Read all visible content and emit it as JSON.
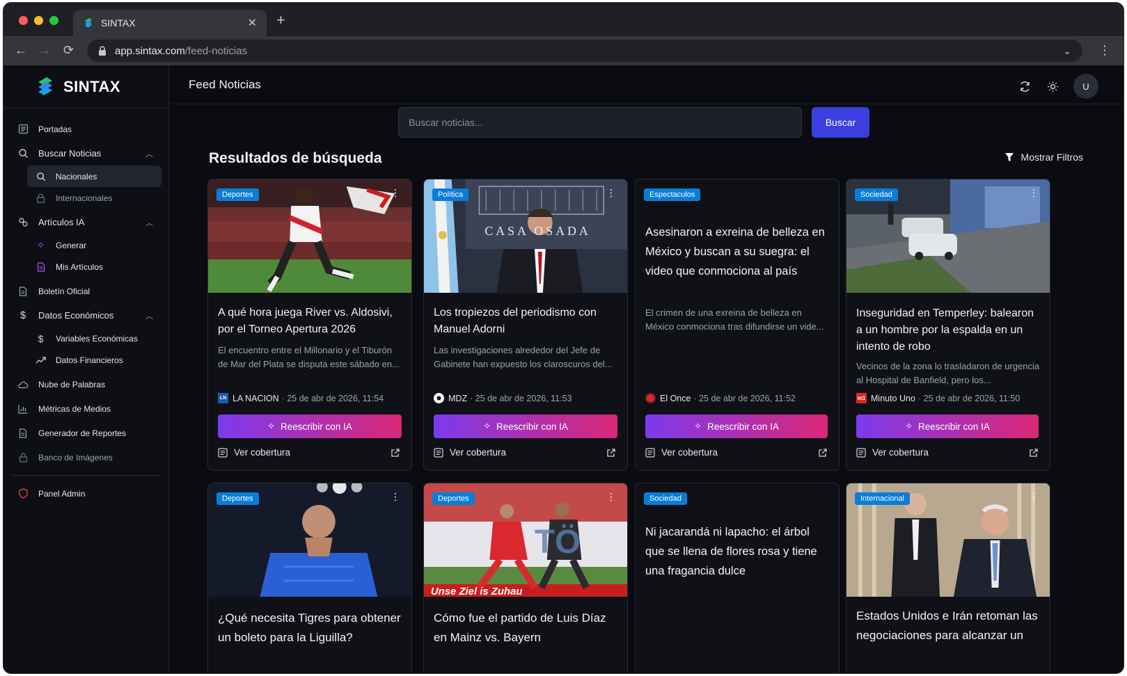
{
  "browser": {
    "tab_title": "SINTAX",
    "url_host": "app.sintax.com",
    "url_path": "/feed-noticias"
  },
  "sidebar": {
    "brand": "SINTAX",
    "items": {
      "portadas": "Portadas",
      "buscar": "Buscar Noticias",
      "nacionales": "Nacionales",
      "internacionales": "Internacionales",
      "articulos": "Artículos IA",
      "generar": "Generar",
      "mis_articulos": "Mis Artículos",
      "boletin": "Boletín Oficial",
      "datos": "Datos Económicos",
      "variables": "Variables Económicas",
      "financieros": "Datos Financieros",
      "nube": "Nube de Palabras",
      "metricas": "Métricas de Medios",
      "reportes": "Generador de Reportes",
      "banco": "Banco de Imágenes",
      "admin": "Panel Admin"
    }
  },
  "header": {
    "title": "Feed Noticias",
    "avatar": "U"
  },
  "search": {
    "placeholder": "Buscar noticias...",
    "button": "Buscar"
  },
  "results": {
    "title": "Resultados de búsqueda",
    "filters": "Mostrar Filtros"
  },
  "labels": {
    "rewrite": "Reescribir con IA",
    "coverage": "Ver cobertura"
  },
  "cards": [
    {
      "category": "Deportes",
      "title": "A qué hora juega River vs. Aldosivi, por el Torneo Apertura 2026",
      "desc": "El encuentro entre el Millonario y el Tiburón de Mar del Plata se disputa este sábado en...",
      "source": "LA NACION",
      "date": "· 25 de abr de 2026, 11:54"
    },
    {
      "category": "Política",
      "title": "Los tropiezos del periodismo con Manuel Adorni",
      "desc": "Las investigaciones alrededor del Jefe de Gabinete han expuesto los claroscuros del...",
      "source": "MDZ",
      "date": "· 25 de abr de 2026, 11:53",
      "image_text": "CASA  OSADA"
    },
    {
      "category": "Espectaculos",
      "title": "Asesinaron a exreina de belleza en México y buscan a su suegra: el video que conmociona al país",
      "desc": "El crimen de una exreina de belleza en México conmociona tras difundirse un vide...",
      "source": "El Once",
      "date": "· 25 de abr de 2026, 11:52"
    },
    {
      "category": "Sociedad",
      "title": "Inseguridad en Temperley: balearon a un hombre por la espalda en un intento de robo",
      "desc": "Vecinos de la zona lo trasladaron de urgencia al Hospital de Banfield, pero los...",
      "source": "Minuto Uno",
      "date": "· 25 de abr de 2026, 11:50"
    },
    {
      "category": "Deportes",
      "title": "¿Qué necesita Tigres para obtener un boleto para la Liguilla?"
    },
    {
      "category": "Deportes",
      "title": "Cómo fue el partido de Luis Díaz en Mainz vs. Bayern",
      "image_text": "Unse  Ziel is  Zuhau"
    },
    {
      "category": "Sociedad",
      "title": "Ni jacarandá ni lapacho: el árbol que se llena de flores rosa y tiene una fragancia dulce"
    },
    {
      "category": "Internacional",
      "title": "Estados Unidos e Irán retoman las negociaciones para alcanzar un"
    }
  ],
  "source_icons": {
    "lanacion": "LN",
    "minutouno": "m1"
  },
  "colors": {
    "accent": "#3b3fe0",
    "badge": "#0a7dd8",
    "gradient_start": "#7c3aed",
    "gradient_end": "#db2777"
  }
}
